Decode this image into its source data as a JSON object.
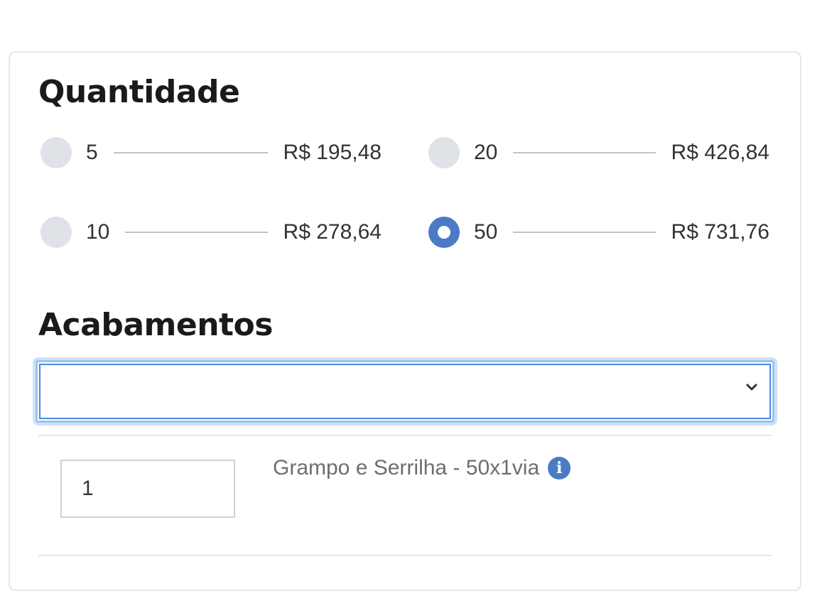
{
  "quantidade": {
    "title": "Quantidade",
    "options": [
      {
        "qty": "5",
        "price": "R$ 195,48",
        "selected": false
      },
      {
        "qty": "20",
        "price": "R$ 426,84",
        "selected": false
      },
      {
        "qty": "10",
        "price": "R$ 278,64",
        "selected": false
      },
      {
        "qty": "50",
        "price": "R$ 731,76",
        "selected": true
      }
    ]
  },
  "acabamentos": {
    "title": "Acabamentos",
    "select_value": "",
    "items": [
      {
        "quantity": "1",
        "label": "Grampo e Serrilha - 50x1via",
        "icon": "info-icon"
      }
    ]
  },
  "colors": {
    "accent": "#4a7bc4",
    "radio_unchecked": "#dfe2e6",
    "focus_ring": "#9ec3ee"
  }
}
